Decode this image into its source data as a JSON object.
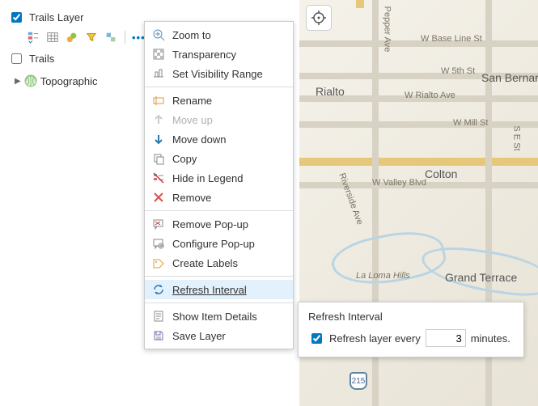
{
  "panel": {
    "layer1": {
      "label": "Trails Layer",
      "checked": true
    },
    "layer2": {
      "label": "Trails",
      "checked": false
    },
    "basemap": {
      "label": "Topographic"
    }
  },
  "menu": {
    "g1": {
      "zoom": "Zoom to",
      "transparency": "Transparency",
      "visibility": "Set Visibility Range"
    },
    "g2": {
      "rename": "Rename",
      "moveup": "Move up",
      "movedown": "Move down",
      "copy": "Copy",
      "hide": "Hide in Legend",
      "remove": "Remove"
    },
    "g3": {
      "removepopup": "Remove Pop-up",
      "configpopup": "Configure Pop-up",
      "labels": "Create Labels"
    },
    "g4": {
      "refresh": "Refresh Interval"
    },
    "g5": {
      "details": "Show Item Details",
      "save": "Save Layer"
    }
  },
  "refresh_popup": {
    "title": "Refresh Interval",
    "checkbox_label": "Refresh layer every",
    "value": "3",
    "unit": "minutes."
  },
  "map": {
    "streets": {
      "baseline": "W Base Line St",
      "pepper": "Pepper Ave",
      "fifth": "W 5th St",
      "rialto_ave": "W Rialto Ave",
      "mill": "W Mill St",
      "sest": "S E St",
      "valley": "W Valley Blvd",
      "riverside": "Riverside Ave"
    },
    "cities": {
      "rialto": "Rialto",
      "sb": "San Bernardino",
      "colton": "Colton",
      "laloma": "La Loma Hills",
      "gt": "Grand Terrace"
    },
    "shields": {
      "r215a": "215",
      "r215b": "215"
    }
  }
}
